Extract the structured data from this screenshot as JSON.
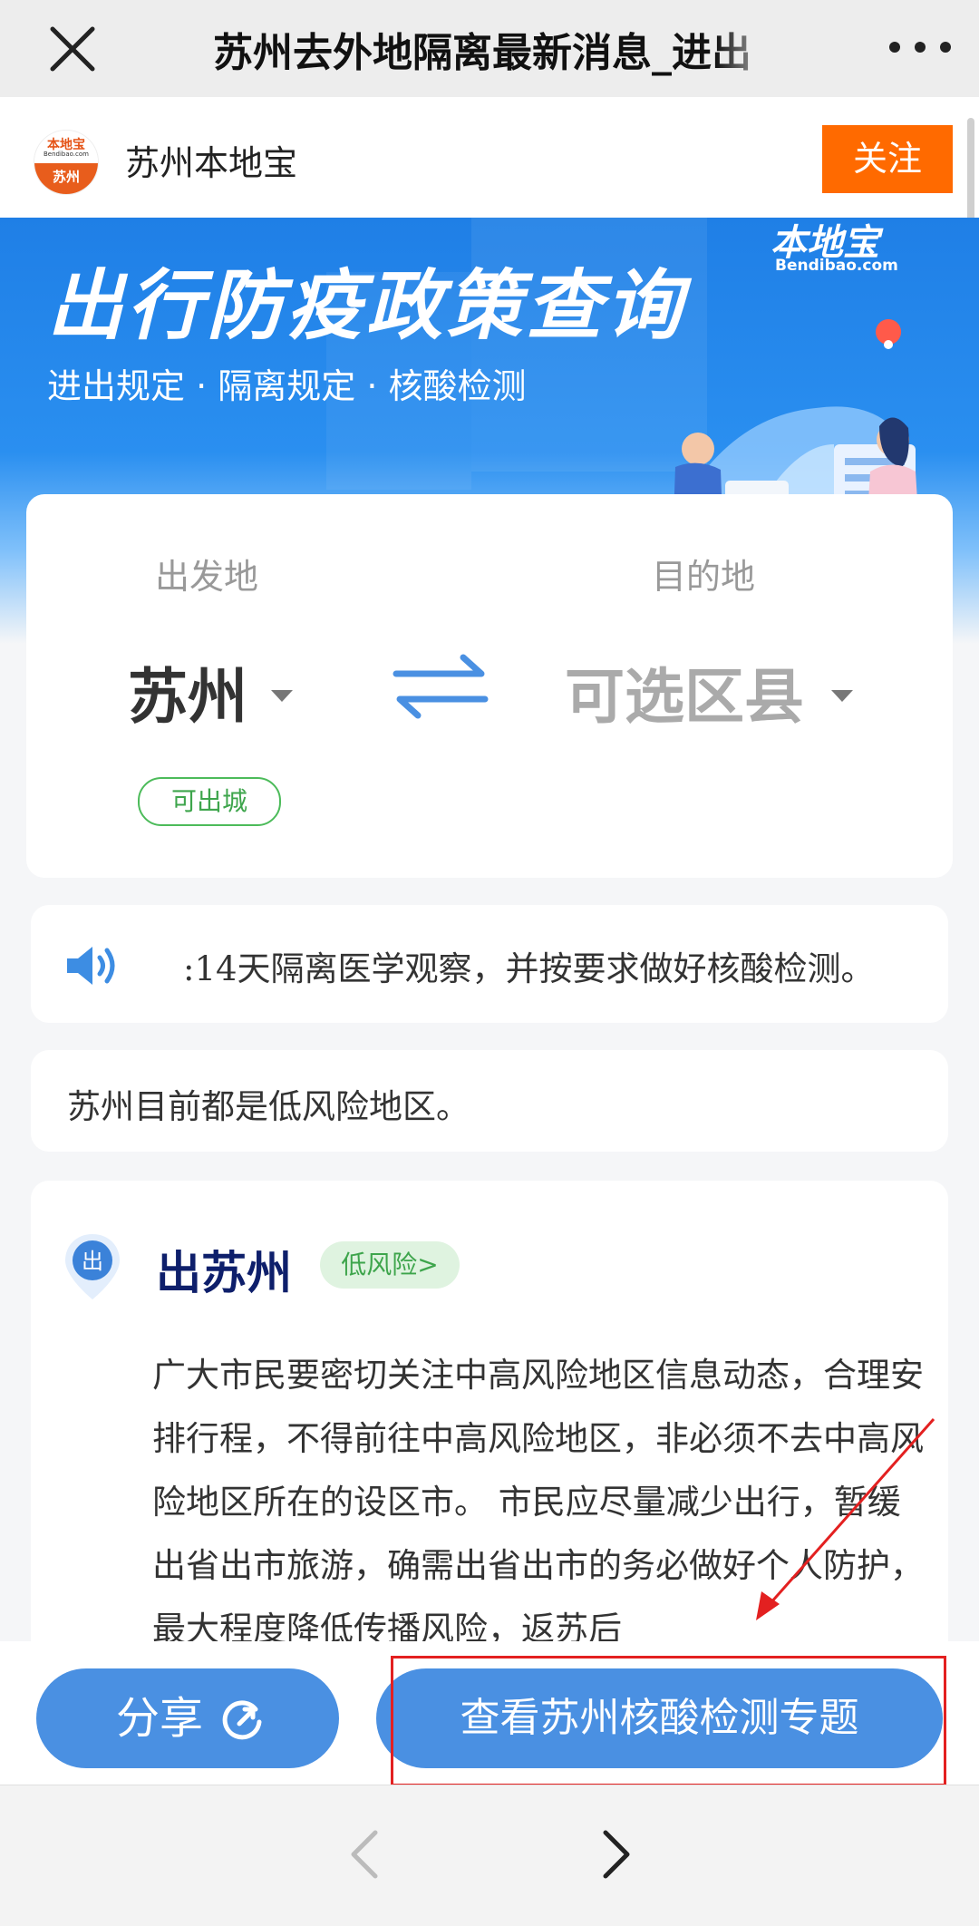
{
  "topbar": {
    "title": "苏州去外地隔离最新消息_进出"
  },
  "account": {
    "name": "苏州本地宝",
    "logo_text": "本地宝",
    "logo_sub": "Bendibao.com",
    "logo_city": "苏州",
    "follow_label": "关注"
  },
  "banner": {
    "headline": "出行防疫政策查询",
    "subtitle": "进出规定 · 隔离规定 · 核酸检测",
    "brand": "本地宝",
    "brand_url": "Bendibao.com"
  },
  "route": {
    "origin_label": "出发地",
    "origin_value": "苏州",
    "dest_label": "目的地",
    "dest_value": "可选区县",
    "origin_status": "可出城"
  },
  "notice": {
    "text": ":14天隔离医学观察，并按要求做好核酸检测。"
  },
  "risk_note": "苏州目前都是低风险地区。",
  "leave": {
    "pin_char": "出",
    "title": "出苏州",
    "risk_badge": "低风险>",
    "paragraph": "广大市民要密切关注中高风险地区信息动态，合理安排行程，不得前往中高风险地区，非必须不去中高风险地区所在的设区市。 市民应尽量减少出行，暂缓出省出市旅游，确需出省出市的务必做好个人防护，最大程度降低传播风险，返苏后"
  },
  "actions": {
    "share_label": "分享",
    "topic_label": "查看苏州核酸检测专题"
  },
  "colors": {
    "accent": "#4a90e2",
    "follow": "#ff6a00",
    "annotation": "#e32020",
    "low_risk": "#3ea54c"
  }
}
